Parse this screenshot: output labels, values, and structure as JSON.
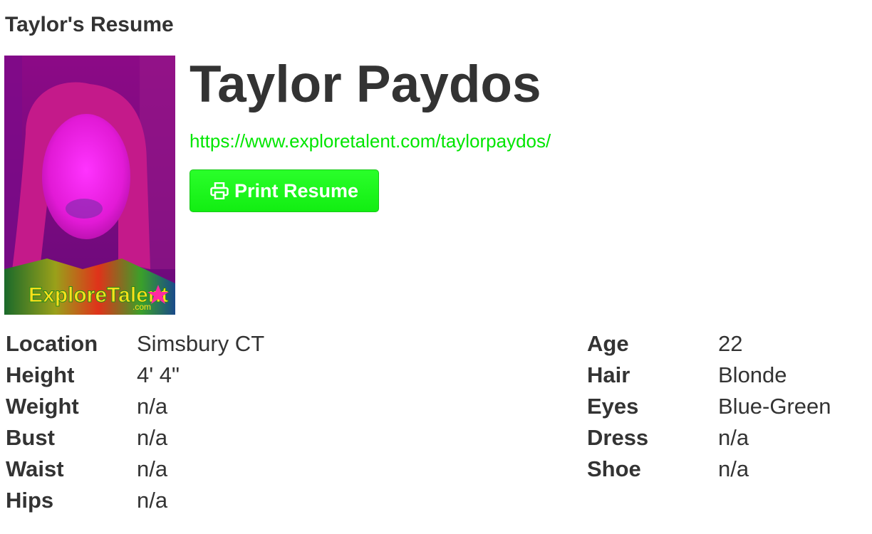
{
  "page": {
    "heading": "Taylor's Resume"
  },
  "profile": {
    "name": "Taylor Paydos",
    "url": "https://www.exploretalent.com/taylorpaydos/",
    "photo_icon": "profile-photo",
    "photo_watermark": "ExploreTalent",
    "photo_watermark_sub": ".com"
  },
  "actions": {
    "print_label": "Print Resume",
    "print_icon": "printer-icon"
  },
  "stats_left": [
    {
      "label": "Location",
      "value": "Simsbury CT"
    },
    {
      "label": "Height",
      "value": "4' 4\""
    },
    {
      "label": "Weight",
      "value": "n/a"
    },
    {
      "label": "Bust",
      "value": "n/a"
    },
    {
      "label": "Waist",
      "value": "n/a"
    },
    {
      "label": "Hips",
      "value": "n/a"
    }
  ],
  "stats_right": [
    {
      "label": "Age",
      "value": "22"
    },
    {
      "label": "Hair",
      "value": "Blonde"
    },
    {
      "label": "Eyes",
      "value": "Blue-Green"
    },
    {
      "label": "Dress",
      "value": "n/a"
    },
    {
      "label": "Shoe",
      "value": "n/a"
    }
  ],
  "colors": {
    "text": "#333333",
    "link": "#00e600",
    "button_bg": "#1ef51e",
    "button_text": "#ffffff",
    "photo_bg": "#8a0a8a"
  }
}
